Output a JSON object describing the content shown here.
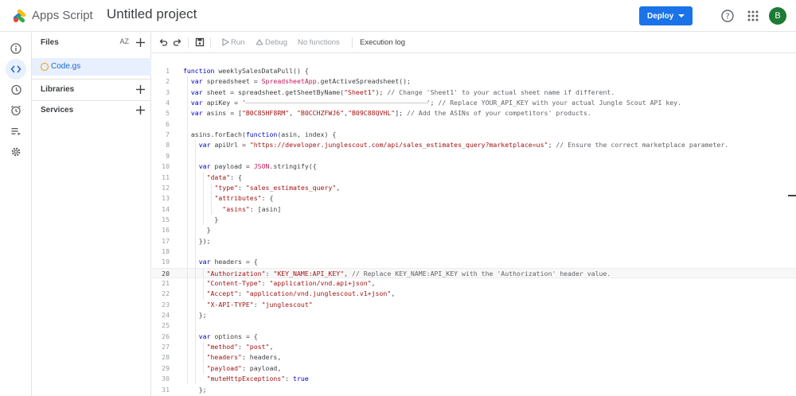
{
  "header": {
    "app_name": "Apps Script",
    "project_title": "Untitled project",
    "deploy_label": "Deploy",
    "avatar_initial": "B",
    "accent_color": "#1a73e8"
  },
  "rail": {
    "items": [
      "info-icon",
      "code-icon",
      "history-icon",
      "alarm-icon",
      "executions-icon",
      "settings-icon"
    ]
  },
  "files_panel": {
    "files_label": "Files",
    "sort_label": "AZ",
    "file_name": "Code.gs",
    "libraries_label": "Libraries",
    "services_label": "Services"
  },
  "toolbar": {
    "run_label": "Run",
    "debug_label": "Debug",
    "function_label": "No functions",
    "execution_log_label": "Execution log"
  },
  "code": {
    "lines": [
      "function weeklySalesDataPull() {",
      "  var spreadsheet = SpreadsheetApp.getActiveSpreadsheet();",
      "  var sheet = spreadsheet.getSheetByName(\"Sheet1\"); // Change 'Sheet1' to your actual sheet name if different.",
      "  var apiKey = '                                              '; // Replace YOUR_API_KEY with your actual Jungle Scout API key.",
      "  var asins = [\"B0C85HF8RM\", \"B0CCHZFWJ6\",\"B09C88QVHL\"]; // Add the ASINs of your competitors' products.",
      "",
      "  asins.forEach(function(asin, index) {",
      "    var apiUrl = \"https://developer.junglescout.com/api/sales_estimates_query?marketplace=us\"; // Ensure the correct marketplace parameter.",
      "",
      "    var payload = JSON.stringify({",
      "      \"data\": {",
      "        \"type\": \"sales_estimates_query\",",
      "        \"attributes\": {",
      "          \"asins\": [asin]",
      "        }",
      "      }",
      "    });",
      "",
      "    var headers = {",
      "      \"Authorization\": \"KEY_NAME:API_KEY\", // Replace KEY_NAME:API_KEY with the 'Authorization' header value.",
      "      \"Content-Type\": \"application/vnd.api+json\",",
      "      \"Accept\": \"application/vnd.junglescout.v1+json\",",
      "      \"X-API-TYPE\": \"junglescout\"",
      "    };",
      "",
      "    var options = {",
      "      \"method\": \"post\",",
      "      \"headers\": headers,",
      "      \"payload\": payload,",
      "      \"muteHttpExceptions\": true",
      "    };"
    ],
    "current_line": 20
  }
}
